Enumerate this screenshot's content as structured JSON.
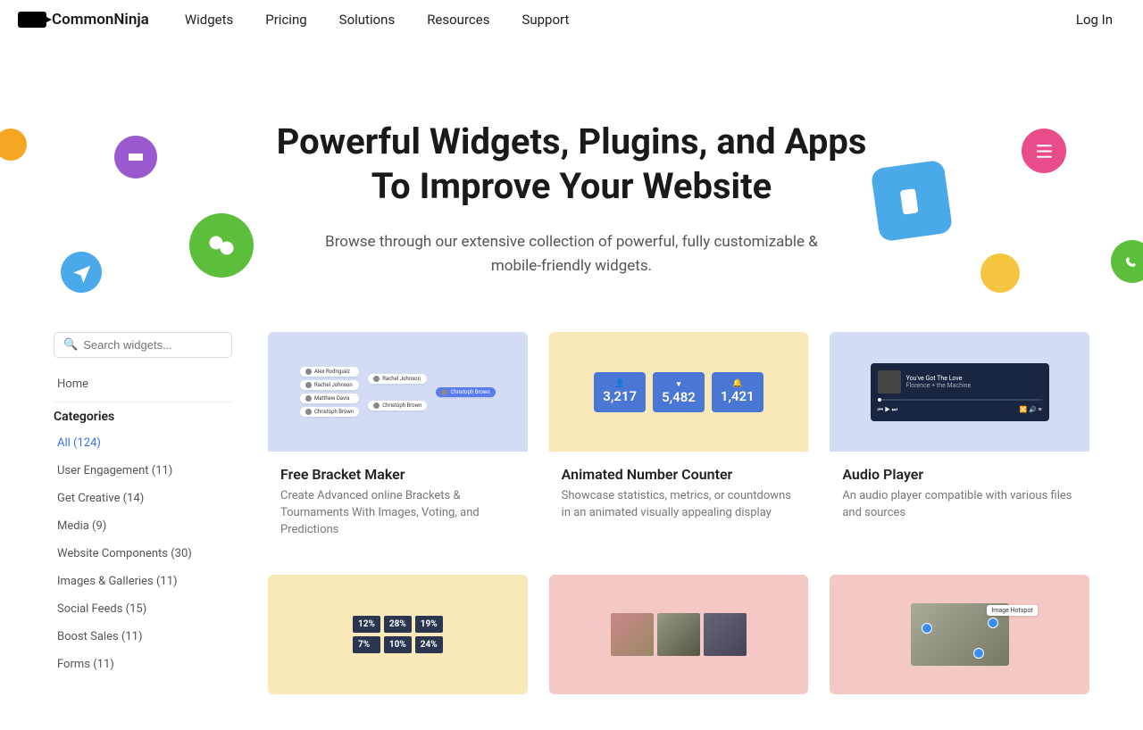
{
  "brand": "CommonNinja",
  "nav": [
    "Widgets",
    "Pricing",
    "Solutions",
    "Resources",
    "Support"
  ],
  "login": "Log In",
  "hero": {
    "title_1": "Powerful Widgets, Plugins, and Apps",
    "title_2": "To Improve Your Website",
    "subtitle": "Browse through our extensive collection of powerful, fully customizable & mobile-friendly widgets."
  },
  "search": {
    "placeholder": "Search widgets..."
  },
  "sidebar": {
    "home": "Home",
    "categories_label": "Categories",
    "items": [
      "All (124)",
      "User Engagement (11)",
      "Get Creative (14)",
      "Media (9)",
      "Website Components (30)",
      "Images & Galleries (11)",
      "Social Feeds (15)",
      "Boost Sales (11)",
      "Forms (11)"
    ]
  },
  "cards": [
    {
      "title": "Free Bracket Maker",
      "desc": "Create Advanced online Brackets & Tournaments With Images, Voting, and Predictions"
    },
    {
      "title": "Animated Number Counter",
      "desc": "Showcase statistics, metrics, or countdowns in an animated visually appealing display"
    },
    {
      "title": "Audio Player",
      "desc": "An audio player compatible with various files and sources"
    },
    {
      "title": "",
      "desc": ""
    },
    {
      "title": "",
      "desc": ""
    },
    {
      "title": "",
      "desc": ""
    }
  ],
  "bracket_names": [
    "Alex Rodriguez",
    "Rachel Johnson",
    "Matthew Davis",
    "Christoph Brown",
    "Rachel Johnson",
    "Christoph Brown",
    "Christoph Brown"
  ],
  "counters": [
    {
      "icon": "👤",
      "value": "3,217"
    },
    {
      "icon": "♥",
      "value": "5,482"
    },
    {
      "icon": "🔔",
      "value": "1,421"
    }
  ],
  "audio": {
    "title": "You've Got The Love",
    "artist": "Florence + the Machine"
  },
  "tiles": [
    "12%",
    "28%",
    "19%",
    "7%",
    "10%",
    "24%"
  ],
  "hotspot_label": "Image Hotspot"
}
